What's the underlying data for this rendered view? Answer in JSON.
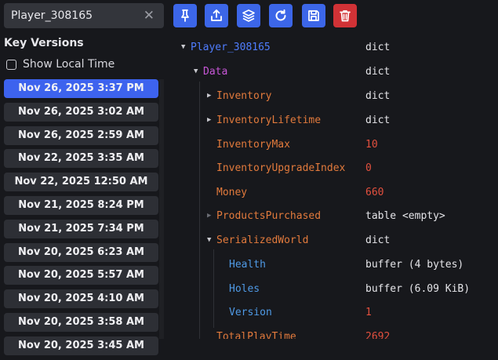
{
  "search": {
    "value": "Player_308165",
    "clear_icon": "close-icon"
  },
  "toolbar": {
    "buttons": [
      {
        "name": "pin-icon",
        "color": "#3c66e8"
      },
      {
        "name": "export-icon",
        "color": "#3c66e8"
      },
      {
        "name": "layers-icon",
        "color": "#3c66e8"
      },
      {
        "name": "refresh-icon",
        "color": "#3c66e8"
      },
      {
        "name": "save-icon",
        "color": "#3c66e8"
      },
      {
        "name": "trash-icon",
        "color": "#d13236"
      }
    ]
  },
  "sidebar": {
    "title": "Key Versions",
    "show_local_time": "Show Local Time",
    "versions": [
      "Nov 26, 2025 3:37 PM",
      "Nov 26, 2025 3:02 AM",
      "Nov 26, 2025 2:59 AM",
      "Nov 22, 2025 3:35 AM",
      "Nov 22, 2025 12:50 AM",
      "Nov 21, 2025 8:24 PM",
      "Nov 21, 2025 7:34 PM",
      "Nov 20, 2025 6:23 AM",
      "Nov 20, 2025 5:57 AM",
      "Nov 20, 2025 4:10 AM",
      "Nov 20, 2025 3:58 AM",
      "Nov 20, 2025 3:45 AM"
    ]
  },
  "tree": {
    "rows": [
      {
        "key": "Player_308165",
        "type": "dict",
        "expanded": true
      },
      {
        "key": "Data",
        "type": "dict",
        "expanded": true
      },
      {
        "key": "Inventory",
        "type": "dict",
        "expanded": false
      },
      {
        "key": "InventoryLifetime",
        "type": "dict",
        "expanded": false
      },
      {
        "key": "InventoryMax",
        "value": "10"
      },
      {
        "key": "InventoryUpgradeIndex",
        "value": "0"
      },
      {
        "key": "Money",
        "value": "660"
      },
      {
        "key": "ProductsPurchased",
        "type": "table <empty>",
        "expanded": false
      },
      {
        "key": "SerializedWorld",
        "type": "dict",
        "expanded": true
      },
      {
        "key": "Health",
        "type": "buffer (4 bytes)"
      },
      {
        "key": "Holes",
        "type": "buffer (6.09 KiB)"
      },
      {
        "key": "Version",
        "value": "1"
      },
      {
        "key": "TotalPlayTime",
        "value": "2692"
      }
    ]
  },
  "colors": {
    "accent": "#3d63ee",
    "danger": "#d13236",
    "key_root": "#4f7dff",
    "key_table": "#c857d8",
    "key_field": "#e27a3c",
    "key_nested": "#4f9ae6",
    "value_number": "#e2503e"
  }
}
